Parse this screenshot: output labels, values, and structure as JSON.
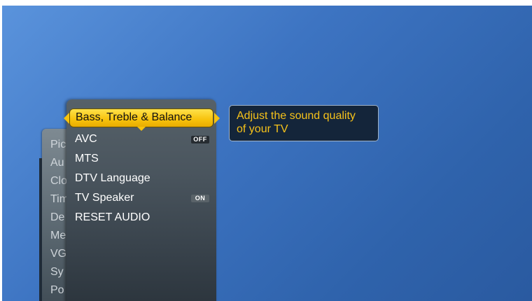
{
  "main_menu": {
    "items": [
      "Pic",
      "Au",
      "Clo",
      "Tim",
      "De",
      "Me",
      "VG",
      "Sy",
      "Po"
    ]
  },
  "audio_menu": {
    "selected_label": "Bass, Treble & Balance",
    "items": [
      {
        "label": "AVC",
        "badge": "OFF"
      },
      {
        "label": "MTS",
        "badge": ""
      },
      {
        "label": "DTV Language",
        "badge": ""
      },
      {
        "label": "TV Speaker",
        "badge": "ON"
      },
      {
        "label": "RESET AUDIO",
        "badge": ""
      }
    ]
  },
  "description": {
    "line1": "Adjust the sound quality",
    "line2": "of your TV"
  },
  "colors": {
    "highlight": "#f7c20c",
    "description_text": "#f6c21a",
    "background": "#3d74c2"
  }
}
